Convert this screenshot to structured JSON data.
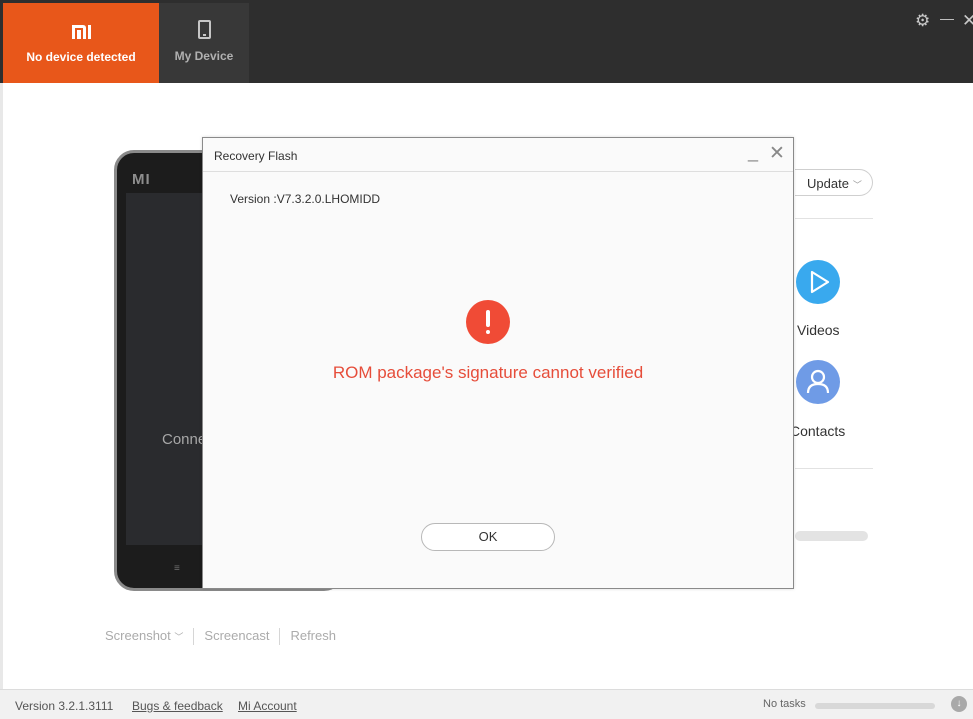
{
  "header": {
    "tabs": [
      {
        "label": "No device detected",
        "icon": "mi-logo-icon",
        "active": true
      },
      {
        "label": "My Device",
        "icon": "phone-icon",
        "active": false
      }
    ],
    "window_controls": {
      "settings": "⚙",
      "minimize": "—",
      "close": "✕"
    }
  },
  "phone_mockup": {
    "brand": "mi",
    "status_text": "Connec"
  },
  "background": {
    "update_label": "Update",
    "features": [
      {
        "label": "Videos",
        "icon": "play-icon",
        "color": "#39a9ee"
      },
      {
        "label": "Contacts",
        "icon": "user-icon",
        "color": "#6f9be6"
      }
    ]
  },
  "actions": {
    "screenshot": "Screenshot",
    "screencast": "Screencast",
    "refresh": "Refresh"
  },
  "statusbar": {
    "version": "Version 3.2.1.3111",
    "bugs_link": "Bugs & feedback",
    "account_link": "Mi Account",
    "tasks": "No tasks"
  },
  "dialog": {
    "title": "Recovery Flash",
    "version": "Version :V7.3.2.0.LHOMIDD",
    "message": "ROM package's signature cannot verified",
    "ok_label": "OK",
    "minimize": "_",
    "close": "✕"
  },
  "colors": {
    "accent": "#e8571a",
    "error": "#e64d3a",
    "topbar": "#2e2e2e"
  }
}
